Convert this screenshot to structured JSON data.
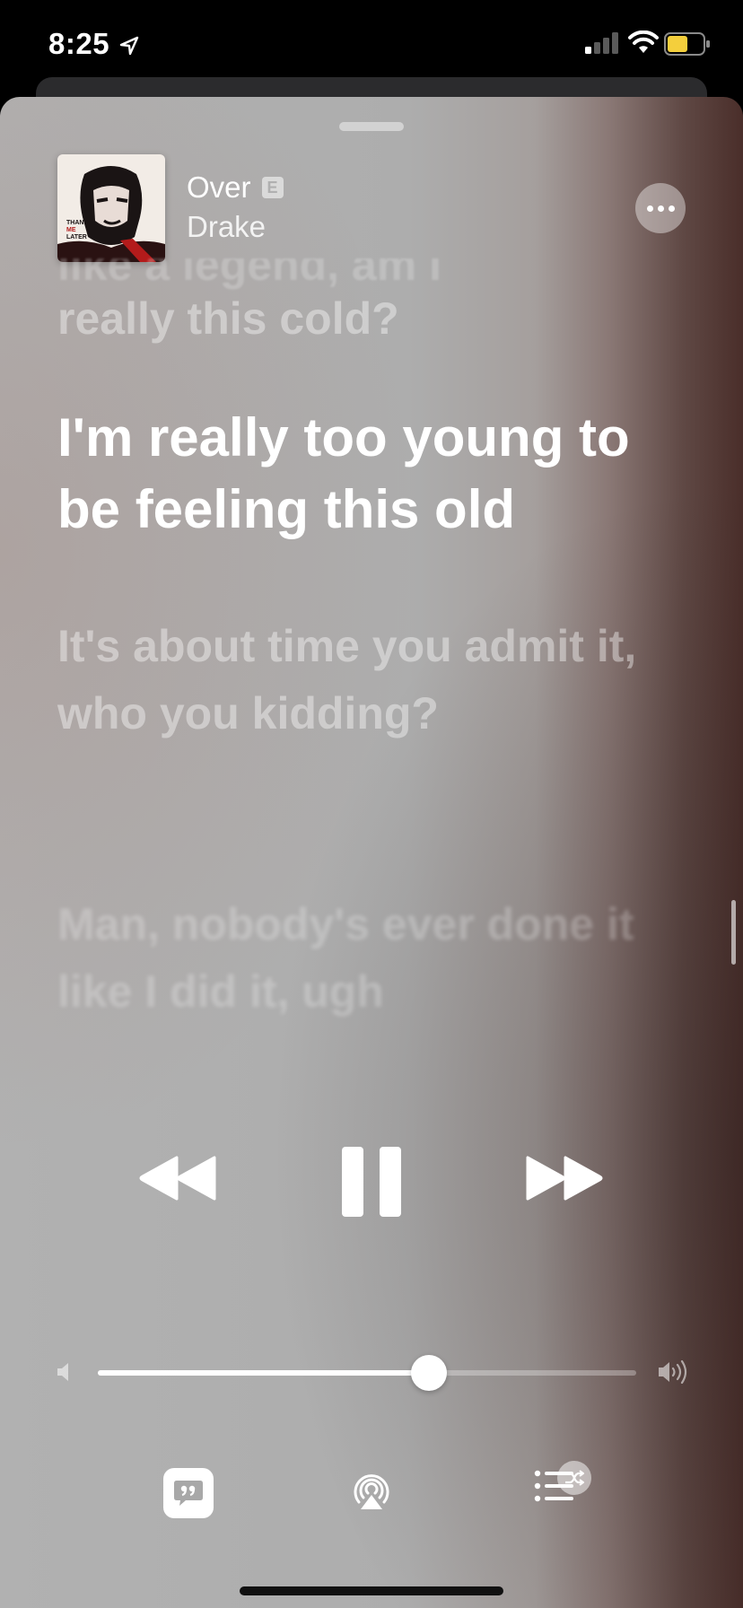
{
  "status_bar": {
    "time": "8:25"
  },
  "now_playing": {
    "title": "Over",
    "explicit_label": "E",
    "artist": "Drake",
    "album_art_text": [
      "THANK",
      "ME",
      "LATER"
    ]
  },
  "lyrics": {
    "previous_partial": "like a legend, am I",
    "previous": "really this cold?",
    "current": "I'm really too young to be feeling this old",
    "next": "It's about time you admit it, who you kidding?",
    "next_2": "Man, nobody's ever done it like I did it, ugh"
  },
  "playback": {
    "state": "playing"
  },
  "volume": {
    "level": 0.615
  }
}
